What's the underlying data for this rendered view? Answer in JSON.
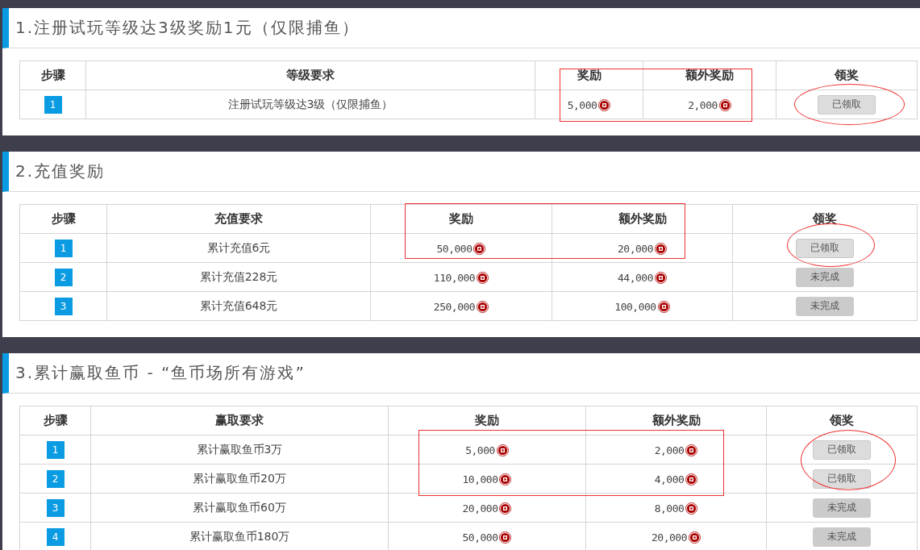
{
  "sections": [
    {
      "title": "1.注册试玩等级达3级奖励1元（仅限捕鱼）",
      "columns": [
        "步骤",
        "等级要求",
        "奖励",
        "额外奖励",
        "领奖"
      ],
      "rows": [
        {
          "step": "1",
          "requirement": "注册试玩等级达3级（仅限捕鱼）",
          "reward": "5,000",
          "bonus": "2,000",
          "button": "已领取",
          "claimed": true
        }
      ]
    },
    {
      "title": "2.充值奖励",
      "columns": [
        "步骤",
        "充值要求",
        "奖励",
        "额外奖励",
        "领奖"
      ],
      "rows": [
        {
          "step": "1",
          "requirement": "累计充值6元",
          "reward": "50,000",
          "bonus": "20,000",
          "button": "已领取",
          "claimed": true
        },
        {
          "step": "2",
          "requirement": "累计充值228元",
          "reward": "110,000",
          "bonus": "44,000",
          "button": "未完成",
          "claimed": false
        },
        {
          "step": "3",
          "requirement": "累计充值648元",
          "reward": "250,000",
          "bonus": "100,000",
          "button": "未完成",
          "claimed": false
        }
      ]
    },
    {
      "title": "3.累计赢取鱼币 - “鱼币场所有游戏”",
      "columns": [
        "步骤",
        "赢取要求",
        "奖励",
        "额外奖励",
        "领奖"
      ],
      "rows": [
        {
          "step": "1",
          "requirement": "累计赢取鱼币3万",
          "reward": "5,000",
          "bonus": "2,000",
          "button": "已领取",
          "claimed": true
        },
        {
          "step": "2",
          "requirement": "累计赢取鱼币20万",
          "reward": "10,000",
          "bonus": "4,000",
          "button": "已领取",
          "claimed": true
        },
        {
          "step": "3",
          "requirement": "累计赢取鱼币60万",
          "reward": "20,000",
          "bonus": "8,000",
          "button": "未完成",
          "claimed": false
        },
        {
          "step": "4",
          "requirement": "累计赢取鱼币180万",
          "reward": "50,000",
          "bonus": "20,000",
          "button": "未完成",
          "claimed": false
        }
      ]
    }
  ]
}
